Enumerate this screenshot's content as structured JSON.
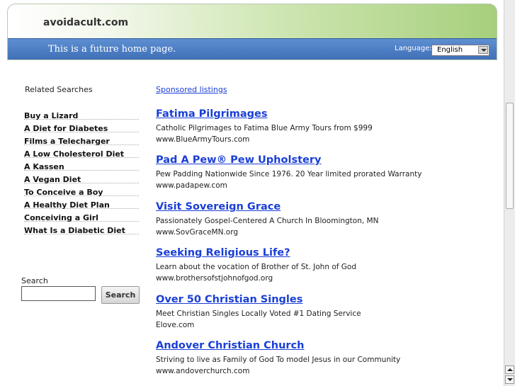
{
  "header": {
    "site_title": "avoidacult.com",
    "tagline": "This is a future home page.",
    "language_label": "Language:",
    "language_value": "English"
  },
  "left": {
    "related_title": "Related Searches",
    "related": [
      "Buy a Lizard",
      "A Diet for Diabetes",
      "Films a Telecharger",
      "A Low Cholesterol Diet",
      "A Kassen",
      "A Vegan Diet",
      "To Conceive a Boy",
      "A Healthy Diet Plan",
      "Conceiving a Girl",
      "What Is a Diabetic Diet"
    ],
    "search_label": "Search",
    "search_button": "Search"
  },
  "main": {
    "sponsored": "Sponsored listings",
    "listings": [
      {
        "title": "Fatima Pilgrimages",
        "desc": "Catholic Pilgrimages to Fatima Blue Army Tours from $999",
        "url": "www.BlueArmyTours.com"
      },
      {
        "title": "Pad A Pew® Pew Upholstery",
        "desc": "Pew Padding Nationwide Since 1976. 20 Year limited prorated Warranty",
        "url": "www.padapew.com"
      },
      {
        "title": "Visit Sovereign Grace",
        "desc": "Passionately Gospel-Centered A Church In Bloomington, MN",
        "url": "www.SovGraceMN.org"
      },
      {
        "title": "Seeking Religious Life?",
        "desc": "Learn about the vocation of Brother of St. John of God",
        "url": "www.brothersofstjohnofgod.org"
      },
      {
        "title": "Over 50 Christian Singles",
        "desc": "Meet Christian Singles Locally Voted #1 Dating Service",
        "url": "Elove.com"
      },
      {
        "title": "Andover Christian Church",
        "desc": "Striving to live as Family of God To model Jesus in our Community",
        "url": "www.andoverchurch.com"
      }
    ]
  }
}
